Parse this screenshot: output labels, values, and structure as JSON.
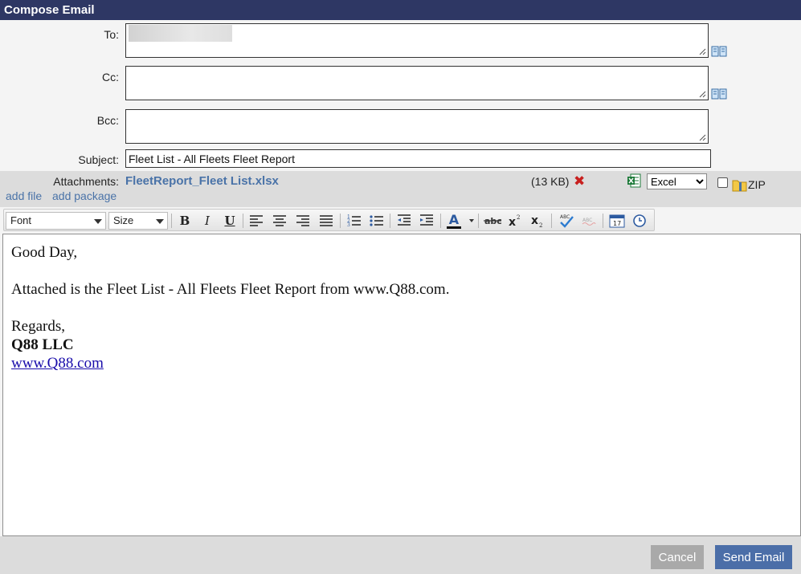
{
  "window": {
    "title": "Compose Email"
  },
  "fields": {
    "to_label": "To:",
    "to_value": "",
    "cc_label": "Cc:",
    "cc_value": "",
    "bcc_label": "Bcc:",
    "bcc_value": "",
    "subject_label": "Subject:",
    "subject_value": "Fleet List - All Fleets Fleet Report",
    "address_book_icon": "address-book-icon"
  },
  "attachments": {
    "label": "Attachments:",
    "file_name": "FleetReport_Fleet List.xlsx",
    "file_size": "(13 KB)",
    "remove_icon": "red-x-icon",
    "file_type_icon": "excel-icon",
    "format_selected": "Excel",
    "zip_label": "ZIP",
    "zip_checked": false,
    "add_file": "add file",
    "add_package": "add package"
  },
  "toolbar": {
    "font": "Font",
    "size": "Size",
    "bold": "B",
    "italic": "I",
    "underline": "U",
    "font_color": "A"
  },
  "body": {
    "greeting": "Good Day,",
    "message": "Attached is the Fleet List - All Fleets Fleet Report from www.Q88.com.",
    "closing": "Regards,",
    "company": "Q88 LLC",
    "website": "www.Q88.com"
  },
  "actions": {
    "cancel": "Cancel",
    "send": "Send Email"
  },
  "colors": {
    "title_bar": "#2e3764",
    "link": "#4a73a8",
    "send_button": "#4b6ea8",
    "cancel_button": "#a9a9a9",
    "remove": "#c8201f"
  }
}
